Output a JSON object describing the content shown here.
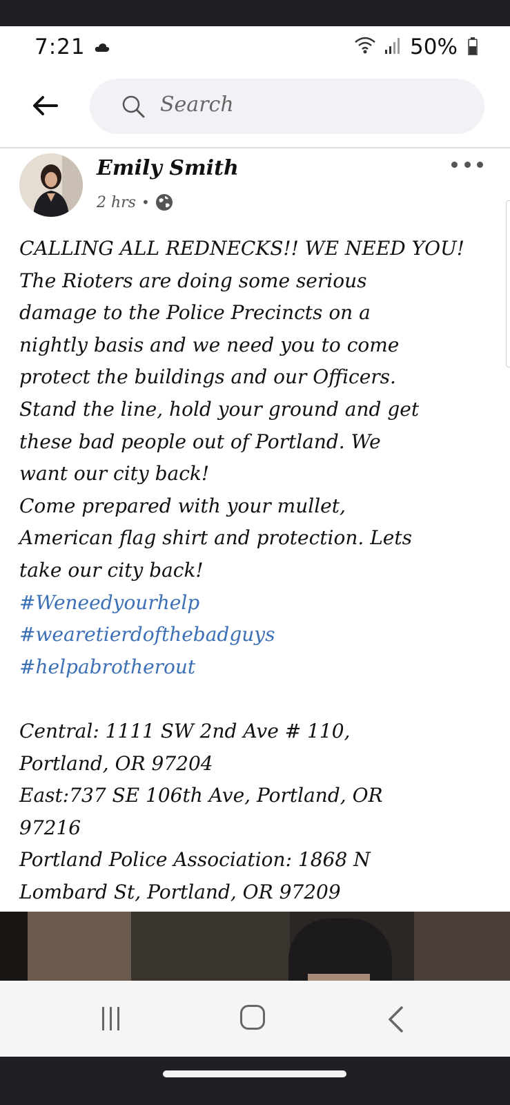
{
  "status_bar": {
    "time": "7:21",
    "battery": "50%",
    "icons": [
      "cloud-icon",
      "wifi-icon",
      "signal-icon",
      "battery-icon"
    ]
  },
  "search": {
    "placeholder": "Search",
    "back_icon": "arrow-left-icon",
    "search_icon": "magnifier-icon"
  },
  "post": {
    "author": "Emily Smith",
    "time": "2 hrs",
    "privacy_icon": "globe-icon",
    "more_icon": "ellipsis-icon",
    "body_lines": [
      "CALLING ALL REDNECKS!! WE NEED YOU!",
      "The Rioters are doing some serious",
      "damage to the Police Precincts on a",
      "nightly basis and we need you to come",
      "protect the buildings and our Officers.",
      "Stand the line, hold your ground and get",
      "these bad people out of Portland. We",
      "want our city back!",
      "Come prepared with your mullet,",
      "American flag shirt and protection. Lets",
      "take our city back!"
    ],
    "hashtags": [
      "#Weneedyourhelp",
      "#wearetierdofthebadguys",
      "#helpabrotherout"
    ],
    "address_lines": [
      "Central: 1111 SW 2nd Ave # 110,",
      "Portland, OR 97204",
      "East:737 SE 106th Ave, Portland, OR",
      "97216",
      "Portland Police Association: 1868 N",
      "Lombard St, Portland, OR 97209"
    ]
  },
  "colors": {
    "hashtag": "#3b6fb6",
    "search_bg": "#f0f2f5",
    "system_bar": "#1f2024"
  },
  "nav_bar": {
    "icons": [
      "recents-icon",
      "home-icon",
      "back-chevron-icon"
    ]
  }
}
